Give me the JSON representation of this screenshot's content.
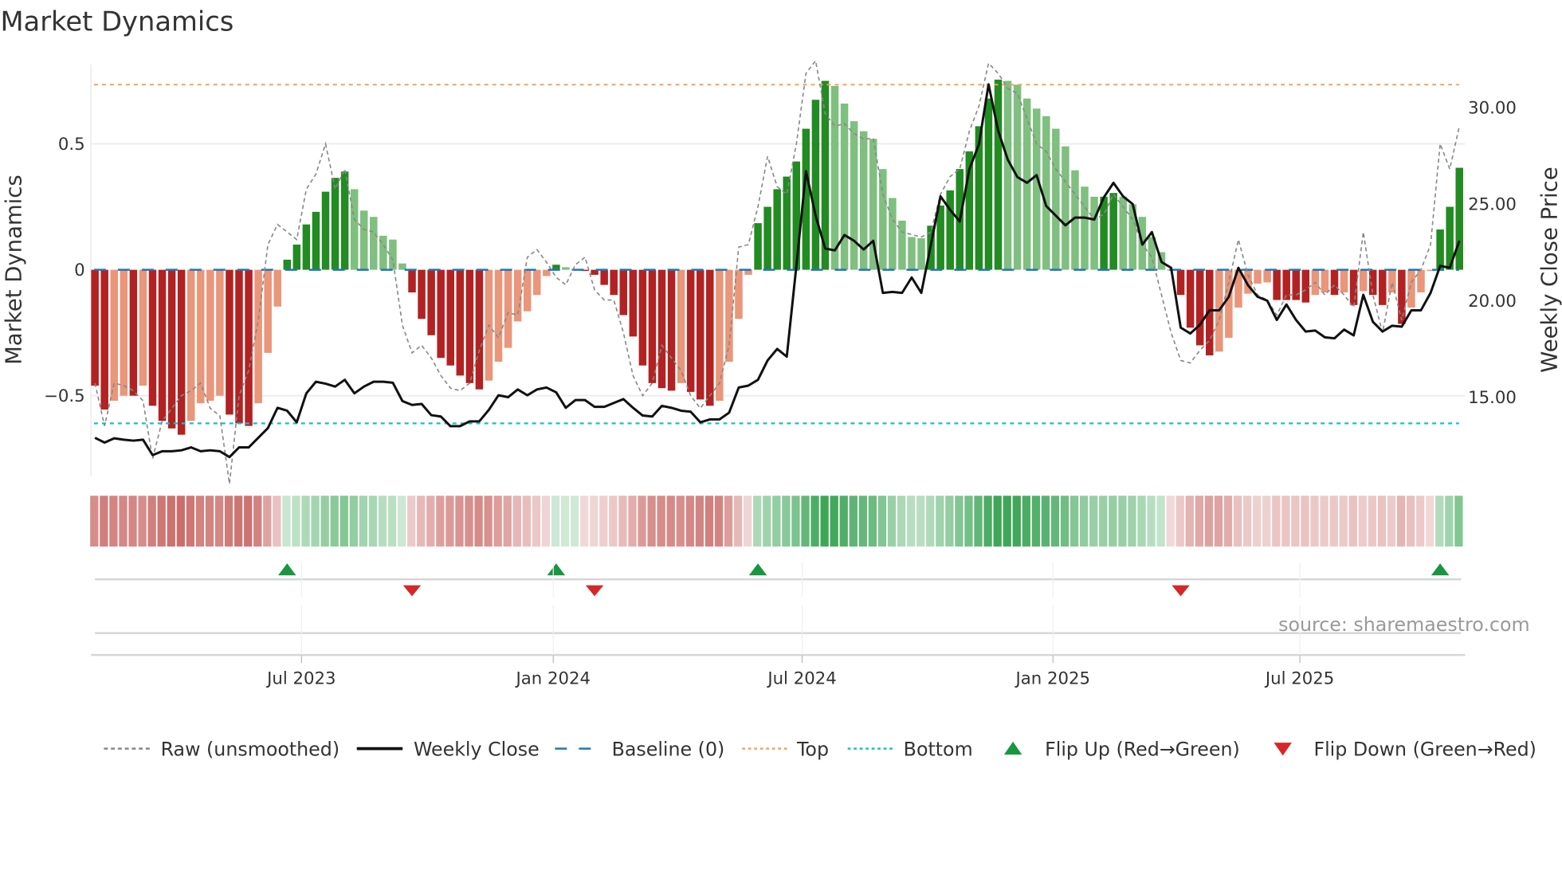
{
  "chart_data": {
    "type": "bar",
    "title": "Market Dynamics",
    "ylabel": "Market Dynamics",
    "ylabel_right": "Weekly Close Price",
    "ylim": [
      -0.82,
      0.82
    ],
    "ylim_right": [
      10.9,
      32.2
    ],
    "y_ticks": [
      {
        "value": 0.5,
        "label": "0.5"
      },
      {
        "value": 0,
        "label": "0"
      },
      {
        "value": -0.5,
        "label": "−0.5"
      }
    ],
    "y_ticks_right": [
      {
        "value": 30,
        "label": "30.00"
      },
      {
        "value": 25,
        "label": "25.00"
      },
      {
        "value": 20,
        "label": "20.00"
      },
      {
        "value": 15,
        "label": "15.00"
      }
    ],
    "x_unit": "week index",
    "x_ticks": [
      {
        "index": 21.5,
        "label": "Jul 2023"
      },
      {
        "index": 47.7,
        "label": "Jan 2024"
      },
      {
        "index": 73.6,
        "label": "Jul 2024"
      },
      {
        "index": 99.7,
        "label": "Jan 2025"
      },
      {
        "index": 125.4,
        "label": "Jul 2025"
      }
    ],
    "grid": true,
    "levels": {
      "baseline": 0,
      "top": 0.735,
      "bottom": -0.61
    },
    "series": [
      {
        "name": "Market Dynamics",
        "type": "bar",
        "values": [
          -0.46,
          -0.555,
          -0.52,
          -0.5,
          -0.5,
          -0.46,
          -0.54,
          -0.6,
          -0.63,
          -0.655,
          -0.6,
          -0.53,
          -0.52,
          -0.5,
          -0.575,
          -0.61,
          -0.62,
          -0.53,
          -0.33,
          -0.146,
          0.04,
          0.1,
          0.18,
          0.23,
          0.31,
          0.365,
          0.39,
          0.32,
          0.235,
          0.21,
          0.135,
          0.12,
          0.025,
          -0.09,
          -0.195,
          -0.26,
          -0.35,
          -0.38,
          -0.42,
          -0.45,
          -0.475,
          -0.44,
          -0.365,
          -0.31,
          -0.205,
          -0.165,
          -0.1,
          -0.025,
          0.02,
          0.01,
          0.003,
          -0.005,
          -0.02,
          -0.06,
          -0.1,
          -0.18,
          -0.265,
          -0.38,
          -0.45,
          -0.47,
          -0.48,
          -0.45,
          -0.485,
          -0.515,
          -0.54,
          -0.52,
          -0.365,
          -0.195,
          -0.02,
          0.185,
          0.25,
          0.32,
          0.37,
          0.43,
          0.56,
          0.675,
          0.75,
          0.73,
          0.66,
          0.59,
          0.55,
          0.52,
          0.4,
          0.285,
          0.195,
          0.13,
          0.125,
          0.175,
          0.255,
          0.315,
          0.4,
          0.47,
          0.57,
          0.68,
          0.755,
          0.75,
          0.735,
          0.68,
          0.64,
          0.61,
          0.56,
          0.49,
          0.395,
          0.33,
          0.29,
          0.29,
          0.305,
          0.29,
          0.26,
          0.21,
          0.13,
          0.07,
          -0.002,
          -0.1,
          -0.23,
          -0.3,
          -0.34,
          -0.325,
          -0.27,
          -0.15,
          -0.095,
          -0.055,
          -0.05,
          -0.12,
          -0.12,
          -0.12,
          -0.13,
          -0.1,
          -0.09,
          -0.1,
          -0.09,
          -0.14,
          -0.085,
          -0.1,
          -0.14,
          -0.09,
          -0.215,
          -0.15,
          -0.09,
          -0.005,
          0.16,
          0.25,
          0.405
        ]
      },
      {
        "name": "Raw (unsmoothed)",
        "type": "line",
        "axis": "left",
        "values": [
          -0.45,
          -0.62,
          -0.45,
          -0.46,
          -0.48,
          -0.52,
          -0.75,
          -0.6,
          -0.55,
          -0.5,
          -0.48,
          -0.45,
          -0.55,
          -0.58,
          -0.85,
          -0.5,
          -0.4,
          -0.2,
          0.1,
          0.18,
          0.15,
          0.12,
          0.32,
          0.38,
          0.5,
          0.32,
          0.4,
          0.2,
          0.16,
          0.15,
          0.1,
          0.04,
          -0.22,
          -0.33,
          -0.3,
          -0.35,
          -0.42,
          -0.47,
          -0.48,
          -0.45,
          -0.32,
          -0.22,
          -0.27,
          -0.17,
          -0.18,
          0.05,
          0.08,
          0.03,
          -0.03,
          -0.06,
          0.02,
          0.05,
          -0.08,
          -0.12,
          -0.12,
          -0.25,
          -0.42,
          -0.5,
          -0.45,
          -0.3,
          -0.35,
          -0.4,
          -0.5,
          -0.55,
          -0.5,
          -0.45,
          -0.3,
          0.09,
          0.1,
          0.25,
          0.45,
          0.33,
          0.3,
          0.5,
          0.78,
          0.83,
          0.62,
          0.57,
          0.58,
          0.54,
          0.52,
          0.52,
          0.3,
          0.2,
          0.15,
          0.14,
          0.13,
          0.15,
          0.3,
          0.37,
          0.4,
          0.55,
          0.65,
          0.82,
          0.78,
          0.72,
          0.7,
          0.6,
          0.5,
          0.47,
          0.4,
          0.35,
          0.3,
          0.25,
          0.2,
          0.22,
          0.3,
          0.25,
          0.2,
          0.1,
          0.05,
          -0.1,
          -0.25,
          -0.36,
          -0.37,
          -0.32,
          -0.28,
          -0.2,
          -0.05,
          0.12,
          -0.02,
          -0.1,
          -0.12,
          -0.18,
          -0.1,
          -0.1,
          -0.08,
          -0.05,
          -0.1,
          -0.06,
          -0.1,
          -0.15,
          0.15,
          -0.1,
          -0.25,
          -0.05,
          -0.2,
          -0.05,
          0.0,
          0.1,
          0.5,
          0.4,
          0.57
        ]
      },
      {
        "name": "Weekly Close",
        "type": "line",
        "axis": "right",
        "values": [
          12.9,
          12.65,
          12.87,
          12.8,
          12.75,
          12.8,
          12.0,
          12.2,
          12.2,
          12.25,
          12.4,
          12.2,
          12.25,
          12.2,
          11.9,
          12.4,
          12.4,
          12.9,
          13.4,
          14.45,
          14.3,
          13.7,
          15.2,
          15.8,
          15.7,
          15.55,
          15.9,
          15.2,
          15.55,
          15.8,
          15.8,
          15.75,
          14.8,
          14.6,
          14.65,
          14.07,
          14.0,
          13.5,
          13.5,
          13.75,
          13.75,
          14.35,
          15.1,
          15.0,
          15.4,
          15.1,
          15.4,
          15.5,
          15.25,
          14.45,
          14.85,
          14.85,
          14.5,
          14.5,
          14.7,
          14.9,
          14.45,
          14.05,
          14.0,
          14.55,
          14.45,
          14.3,
          14.25,
          13.7,
          13.85,
          13.85,
          14.2,
          15.5,
          15.6,
          15.9,
          16.9,
          17.5,
          17.1,
          21.8,
          26.7,
          24.4,
          22.7,
          22.6,
          23.4,
          23.1,
          22.65,
          23.1,
          20.4,
          20.45,
          20.4,
          21.2,
          20.4,
          22.9,
          25.4,
          24.7,
          24.1,
          26.8,
          28.1,
          31.2,
          28.8,
          27.3,
          26.4,
          26.1,
          26.5,
          24.9,
          24.4,
          23.9,
          24.3,
          24.3,
          24.2,
          25.35,
          26.1,
          25.4,
          25.0,
          22.9,
          23.55,
          22.0,
          21.7,
          18.6,
          18.3,
          18.75,
          19.5,
          19.5,
          20.2,
          21.7,
          20.8,
          20.2,
          20.0,
          19.0,
          19.8,
          19.0,
          18.4,
          18.45,
          18.1,
          18.05,
          18.5,
          18.2,
          20.3,
          18.9,
          18.4,
          18.7,
          18.65,
          19.5,
          19.5,
          20.4,
          21.8,
          21.7,
          23.1
        ]
      }
    ],
    "flip_up_index": [
      20,
      48,
      69,
      140
    ],
    "flip_down_index": [
      33,
      52,
      113
    ],
    "legend_position": "bottom",
    "legend": [
      {
        "label": "Raw (unsmoothed)",
        "style": "dashed",
        "color": "#888888"
      },
      {
        "label": "Weekly Close",
        "style": "solid",
        "color": "#111111"
      },
      {
        "label": "Baseline (0)",
        "style": "dash",
        "color": "#1f77b4"
      },
      {
        "label": "Top",
        "style": "dotted",
        "color": "#f4a261"
      },
      {
        "label": "Bottom",
        "style": "dotted",
        "color": "#17becf"
      },
      {
        "label": "Flip Up (Red→Green)",
        "style": "triangle-up",
        "color": "#1a9641"
      },
      {
        "label": "Flip Down (Green→Red)",
        "style": "triangle-down",
        "color": "#d62728"
      }
    ],
    "colors": {
      "bar_pos_strong": "#228b22",
      "bar_pos_weak": "#7fbf7f",
      "bar_neg_strong": "#b22222",
      "bar_neg_weak": "#e9967a",
      "strip_pos": "#2e9e4a",
      "strip_neg": "#c0504d"
    },
    "source": "source: sharemaestro.com"
  }
}
